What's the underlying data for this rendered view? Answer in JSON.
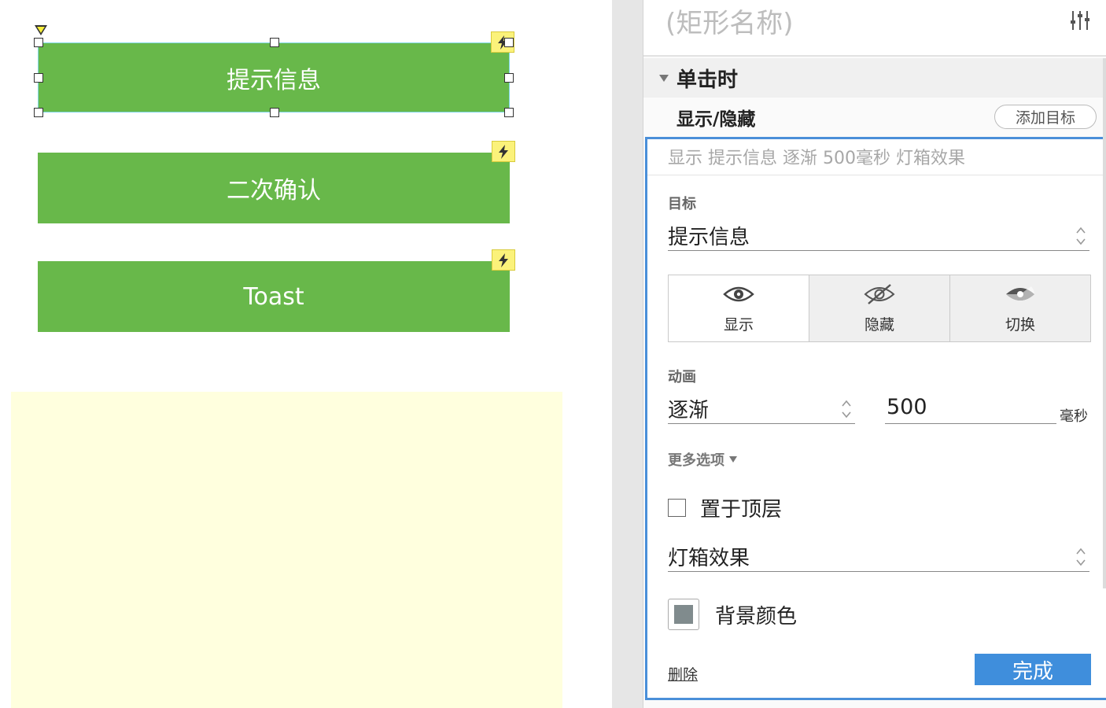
{
  "canvas": {
    "widgets": [
      {
        "label": "提示信息"
      },
      {
        "label": "二次确认"
      },
      {
        "label": "Toast"
      }
    ],
    "colors": {
      "widget_fill": "#68b84a",
      "lightbox_fill": "#ffffde",
      "interaction_badge": "#fbf27a"
    }
  },
  "panel": {
    "name_placeholder": "(矩形名称)",
    "event": {
      "label": "单击时"
    },
    "action": {
      "label": "显示/隐藏",
      "add_target_label": "添加目标"
    },
    "summary": "显示 提示信息 逐渐 500毫秒 灯箱效果",
    "target": {
      "label": "目标",
      "value": "提示信息"
    },
    "visibility": {
      "options": [
        {
          "label": "显示",
          "icon": "eye-icon"
        },
        {
          "label": "隐藏",
          "icon": "eye-slash-icon"
        },
        {
          "label": "切换",
          "icon": "eye-toggle-icon"
        }
      ],
      "selected": "显示"
    },
    "animation": {
      "label": "动画",
      "type": "逐渐",
      "duration": "500",
      "unit": "毫秒"
    },
    "more_options": {
      "label": "更多选项"
    },
    "bring_to_front": {
      "label": "置于顶层",
      "checked": false
    },
    "lightbox": {
      "value": "灯箱效果"
    },
    "background_color": {
      "label": "背景颜色",
      "value": "#808b8d"
    },
    "delete_label": "删除",
    "done_label": "完成",
    "accent_color": "#3f8edc"
  }
}
